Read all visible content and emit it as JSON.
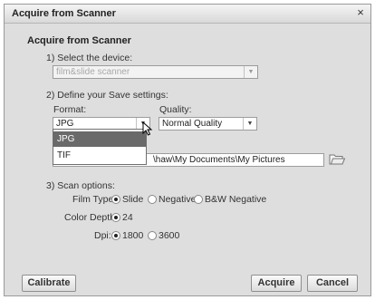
{
  "window": {
    "title": "Acquire from Scanner",
    "close_glyph": "×"
  },
  "heading": "Acquire from Scanner",
  "device": {
    "label": "1) Select the device:",
    "value": "film&slide scanner",
    "arrow": "▼"
  },
  "save": {
    "label": "2) Define your Save settings:",
    "format_label": "Format:",
    "format_value": "JPG",
    "format_options": [
      "JPG",
      "TIF"
    ],
    "quality_label": "Quality:",
    "quality_value": "Normal Quality",
    "path_value": "\\haw\\My Documents\\My Pictures",
    "arrow": "▼"
  },
  "scan": {
    "label": "3) Scan options:",
    "film_type_label": "Film Type:",
    "film_type_options": [
      "Slide",
      "Negative",
      "B&W Negative"
    ],
    "film_type_selected": "Slide",
    "color_depth_label": "Color Depth:",
    "color_depth_value": "24",
    "dpi_label": "Dpi:",
    "dpi_options": [
      "1800",
      "3600"
    ],
    "dpi_selected": "1800"
  },
  "buttons": {
    "calibrate": "Calibrate",
    "acquire": "Acquire",
    "cancel": "Cancel"
  },
  "icons": {
    "folder": "folder-icon",
    "cursor": "mouse-pointer-icon",
    "close": "close-icon"
  }
}
